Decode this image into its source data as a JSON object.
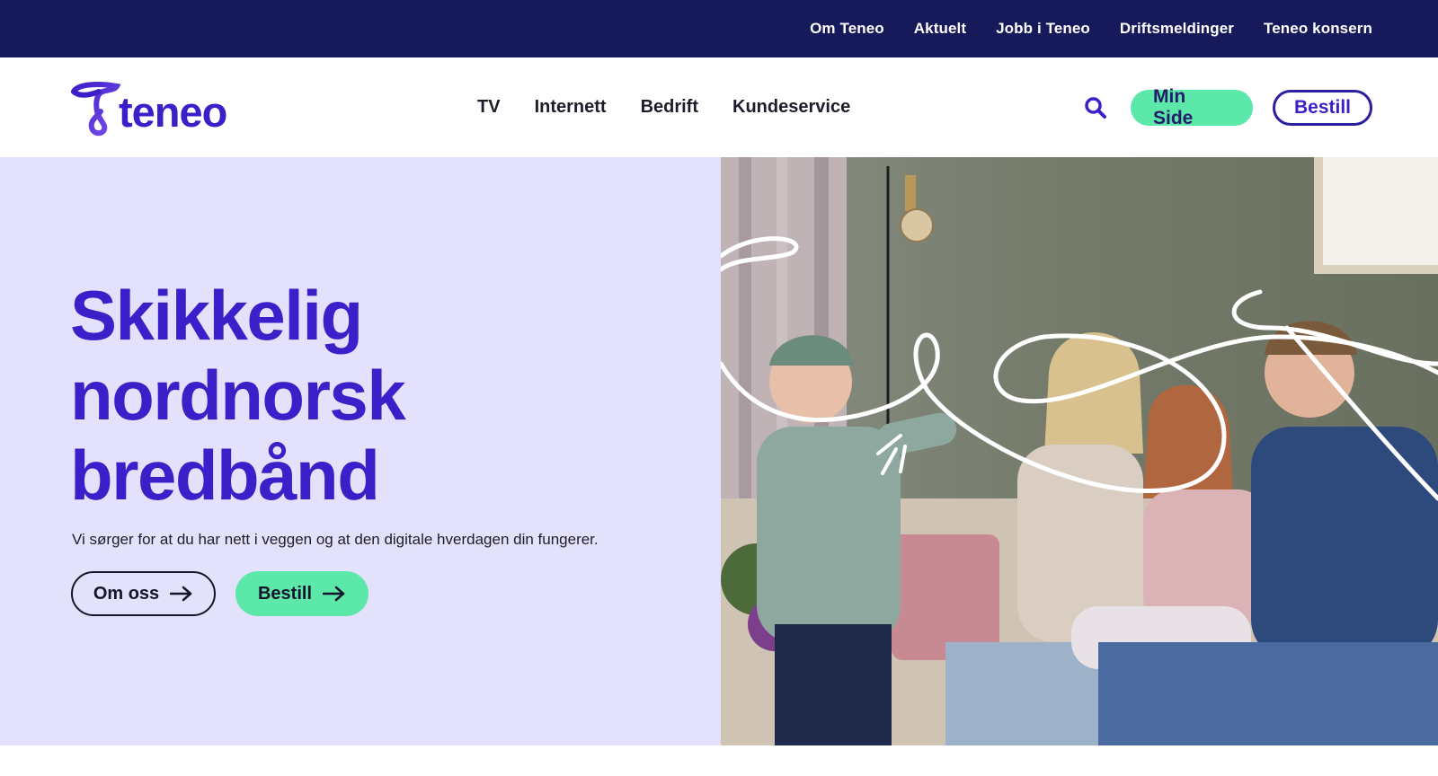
{
  "topbar": {
    "links": [
      "Om Teneo",
      "Aktuelt",
      "Jobb i Teneo",
      "Driftsmeldinger",
      "Teneo konsern"
    ]
  },
  "header": {
    "logo_text": "teneo",
    "nav": [
      "TV",
      "Internett",
      "Bedrift",
      "Kundeservice"
    ],
    "search_icon": "search-icon",
    "min_side_label": "Min Side",
    "bestill_label": "Bestill"
  },
  "hero": {
    "title_lines": [
      "Skikkelig",
      "nordnorsk",
      "bredbånd"
    ],
    "text": "Vi sørger for at du har nett i veggen og at den digitale hverdagen din fungerer.",
    "om_oss_label": "Om oss",
    "bestill_label": "Bestill",
    "arrow_icon": "arrow-right-icon",
    "image_subject": "family-watching-tv-photo"
  },
  "colors": {
    "topbar_bg": "#171a5a",
    "brand_purple": "#3d1fc9",
    "hero_bg": "#e3e1fb",
    "accent_green": "#5be8a8"
  }
}
